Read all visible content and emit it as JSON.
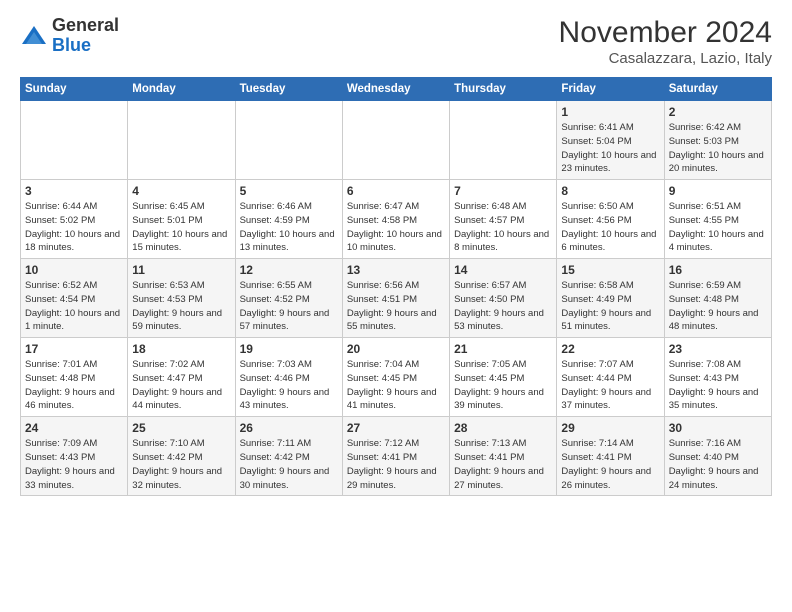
{
  "header": {
    "logo_general": "General",
    "logo_blue": "Blue",
    "month_title": "November 2024",
    "location": "Casalazzara, Lazio, Italy"
  },
  "columns": [
    "Sunday",
    "Monday",
    "Tuesday",
    "Wednesday",
    "Thursday",
    "Friday",
    "Saturday"
  ],
  "weeks": [
    [
      {
        "day": "",
        "info": ""
      },
      {
        "day": "",
        "info": ""
      },
      {
        "day": "",
        "info": ""
      },
      {
        "day": "",
        "info": ""
      },
      {
        "day": "",
        "info": ""
      },
      {
        "day": "1",
        "info": "Sunrise: 6:41 AM\nSunset: 5:04 PM\nDaylight: 10 hours and 23 minutes."
      },
      {
        "day": "2",
        "info": "Sunrise: 6:42 AM\nSunset: 5:03 PM\nDaylight: 10 hours and 20 minutes."
      }
    ],
    [
      {
        "day": "3",
        "info": "Sunrise: 6:44 AM\nSunset: 5:02 PM\nDaylight: 10 hours and 18 minutes."
      },
      {
        "day": "4",
        "info": "Sunrise: 6:45 AM\nSunset: 5:01 PM\nDaylight: 10 hours and 15 minutes."
      },
      {
        "day": "5",
        "info": "Sunrise: 6:46 AM\nSunset: 4:59 PM\nDaylight: 10 hours and 13 minutes."
      },
      {
        "day": "6",
        "info": "Sunrise: 6:47 AM\nSunset: 4:58 PM\nDaylight: 10 hours and 10 minutes."
      },
      {
        "day": "7",
        "info": "Sunrise: 6:48 AM\nSunset: 4:57 PM\nDaylight: 10 hours and 8 minutes."
      },
      {
        "day": "8",
        "info": "Sunrise: 6:50 AM\nSunset: 4:56 PM\nDaylight: 10 hours and 6 minutes."
      },
      {
        "day": "9",
        "info": "Sunrise: 6:51 AM\nSunset: 4:55 PM\nDaylight: 10 hours and 4 minutes."
      }
    ],
    [
      {
        "day": "10",
        "info": "Sunrise: 6:52 AM\nSunset: 4:54 PM\nDaylight: 10 hours and 1 minute."
      },
      {
        "day": "11",
        "info": "Sunrise: 6:53 AM\nSunset: 4:53 PM\nDaylight: 9 hours and 59 minutes."
      },
      {
        "day": "12",
        "info": "Sunrise: 6:55 AM\nSunset: 4:52 PM\nDaylight: 9 hours and 57 minutes."
      },
      {
        "day": "13",
        "info": "Sunrise: 6:56 AM\nSunset: 4:51 PM\nDaylight: 9 hours and 55 minutes."
      },
      {
        "day": "14",
        "info": "Sunrise: 6:57 AM\nSunset: 4:50 PM\nDaylight: 9 hours and 53 minutes."
      },
      {
        "day": "15",
        "info": "Sunrise: 6:58 AM\nSunset: 4:49 PM\nDaylight: 9 hours and 51 minutes."
      },
      {
        "day": "16",
        "info": "Sunrise: 6:59 AM\nSunset: 4:48 PM\nDaylight: 9 hours and 48 minutes."
      }
    ],
    [
      {
        "day": "17",
        "info": "Sunrise: 7:01 AM\nSunset: 4:48 PM\nDaylight: 9 hours and 46 minutes."
      },
      {
        "day": "18",
        "info": "Sunrise: 7:02 AM\nSunset: 4:47 PM\nDaylight: 9 hours and 44 minutes."
      },
      {
        "day": "19",
        "info": "Sunrise: 7:03 AM\nSunset: 4:46 PM\nDaylight: 9 hours and 43 minutes."
      },
      {
        "day": "20",
        "info": "Sunrise: 7:04 AM\nSunset: 4:45 PM\nDaylight: 9 hours and 41 minutes."
      },
      {
        "day": "21",
        "info": "Sunrise: 7:05 AM\nSunset: 4:45 PM\nDaylight: 9 hours and 39 minutes."
      },
      {
        "day": "22",
        "info": "Sunrise: 7:07 AM\nSunset: 4:44 PM\nDaylight: 9 hours and 37 minutes."
      },
      {
        "day": "23",
        "info": "Sunrise: 7:08 AM\nSunset: 4:43 PM\nDaylight: 9 hours and 35 minutes."
      }
    ],
    [
      {
        "day": "24",
        "info": "Sunrise: 7:09 AM\nSunset: 4:43 PM\nDaylight: 9 hours and 33 minutes."
      },
      {
        "day": "25",
        "info": "Sunrise: 7:10 AM\nSunset: 4:42 PM\nDaylight: 9 hours and 32 minutes."
      },
      {
        "day": "26",
        "info": "Sunrise: 7:11 AM\nSunset: 4:42 PM\nDaylight: 9 hours and 30 minutes."
      },
      {
        "day": "27",
        "info": "Sunrise: 7:12 AM\nSunset: 4:41 PM\nDaylight: 9 hours and 29 minutes."
      },
      {
        "day": "28",
        "info": "Sunrise: 7:13 AM\nSunset: 4:41 PM\nDaylight: 9 hours and 27 minutes."
      },
      {
        "day": "29",
        "info": "Sunrise: 7:14 AM\nSunset: 4:41 PM\nDaylight: 9 hours and 26 minutes."
      },
      {
        "day": "30",
        "info": "Sunrise: 7:16 AM\nSunset: 4:40 PM\nDaylight: 9 hours and 24 minutes."
      }
    ]
  ]
}
